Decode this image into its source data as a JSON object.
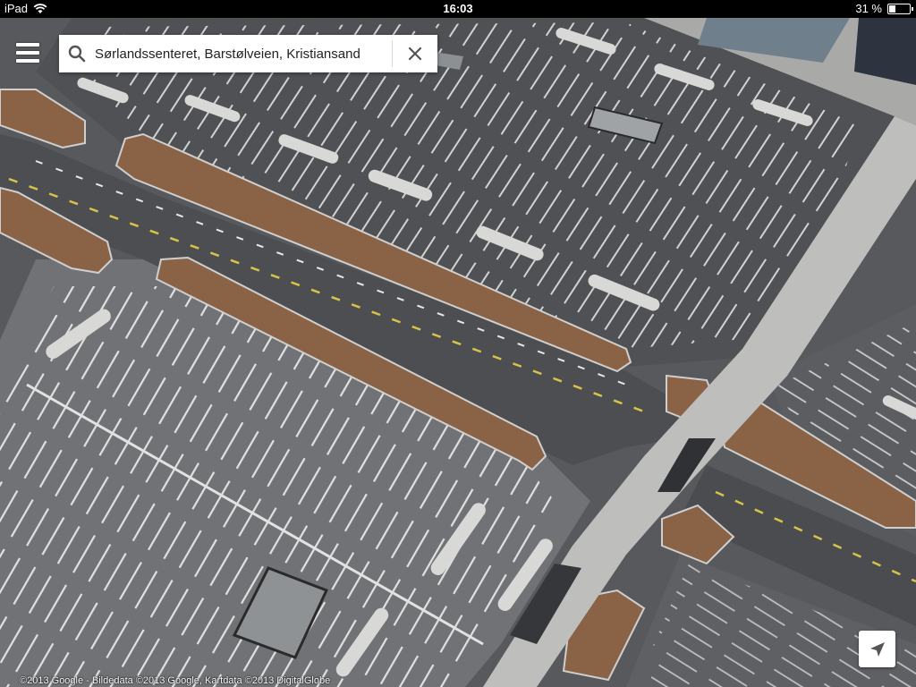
{
  "status_bar": {
    "device": "iPad",
    "time": "16:03",
    "battery_text": "31 %",
    "battery_level": 0.31,
    "wifi_icon": "wifi-icon"
  },
  "search": {
    "query": "Sørlandssenteret, Barstølveien, Kristiansand",
    "icon": "search-icon",
    "clear_icon": "close-icon"
  },
  "menu": {
    "icon": "hamburger-menu-icon"
  },
  "locate": {
    "icon": "location-arrow-icon"
  },
  "copyright": "©2013 Google - Bildedata ©2013 Google, Kartdata ©2013 DigitalGlobe",
  "colors": {
    "asphalt": "#5a5c5f",
    "lot_light": "#76787b",
    "road": "#4e5053",
    "island": "#8a6246",
    "sidewalk": "#bfbfbd",
    "line": "#e8e8e8",
    "road_marking": "#d9c24a"
  }
}
